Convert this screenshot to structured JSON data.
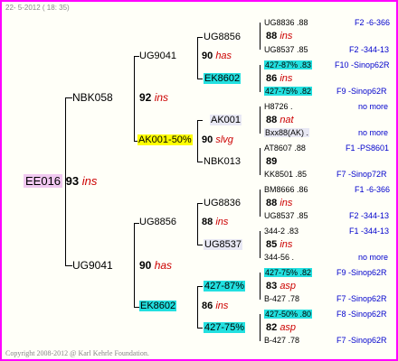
{
  "header": {
    "text": "22- 5-2012 ( 18: 35)"
  },
  "footer": {
    "text": "Copyright 2008-2012 @ Karl Kehrle Foundation."
  },
  "root": {
    "id": "EE016",
    "num": "93",
    "tag": "ins"
  },
  "sire": {
    "id": "NBK058",
    "num": "92",
    "tag": "ins"
  },
  "dam": {
    "id": "UG9041",
    "num": "90",
    "tag": "has"
  },
  "gen3": [
    {
      "id": "UG9041",
      "num": "90",
      "tag": "has"
    },
    {
      "id": "AK001-50%",
      "num": "90",
      "tag": "slvg"
    },
    {
      "id": "UG8856",
      "num": "88",
      "tag": "ins"
    },
    {
      "id": "EK8602",
      "num": "86",
      "tag": "ins"
    }
  ],
  "gen4": [
    {
      "id": "UG8856"
    },
    {
      "id": "EK8602"
    },
    {
      "id": "AK001"
    },
    {
      "id": "NBK013"
    },
    {
      "id": "UG8836"
    },
    {
      "id": "UG8537"
    },
    {
      "id": "427-87%"
    },
    {
      "id": "427-75%"
    }
  ],
  "gen5": [
    {
      "id": "UG8836 .88",
      "loc": "F2 -6-366"
    },
    {
      "id": "88",
      "tag": "ins"
    },
    {
      "id": "UG8537 .85",
      "loc": "F2 -344-13"
    },
    {
      "id": "427-87% .83",
      "loc": "F10 -Sinop62R"
    },
    {
      "id": "86",
      "tag": "ins"
    },
    {
      "id": "427-75% .82",
      "loc": "F9 -Sinop62R"
    },
    {
      "id": "H8726 .",
      "loc": "no more"
    },
    {
      "id": "88",
      "tag": "nat"
    },
    {
      "id": "Bxx88(AK) .",
      "loc": "no more"
    },
    {
      "id": "AT8607 .88",
      "loc": "F1 -PS8601"
    },
    {
      "id": "89",
      "tag": ""
    },
    {
      "id": "KK8501 .85",
      "loc": "F7 -Sinop72R"
    },
    {
      "id": "BM8666 .86",
      "loc": "F1 -6-366"
    },
    {
      "id": "88",
      "tag": "ins"
    },
    {
      "id": "UG8537 .85",
      "loc": "F2 -344-13"
    },
    {
      "id": "344-2 .83",
      "loc": "F1 -344-13"
    },
    {
      "id": "85",
      "tag": "ins"
    },
    {
      "id": "344-56 .",
      "loc": "no more"
    },
    {
      "id": "427-75% .82",
      "loc": "F9 -Sinop62R"
    },
    {
      "id": "83",
      "tag": "asp"
    },
    {
      "id": "B-427 .78",
      "loc": "F7 -Sinop62R"
    },
    {
      "id": "427-50% .80",
      "loc": "F8 -Sinop62R"
    },
    {
      "id": "82",
      "tag": "asp"
    },
    {
      "id": "B-427 .78",
      "loc": "F7 -Sinop62R"
    }
  ]
}
